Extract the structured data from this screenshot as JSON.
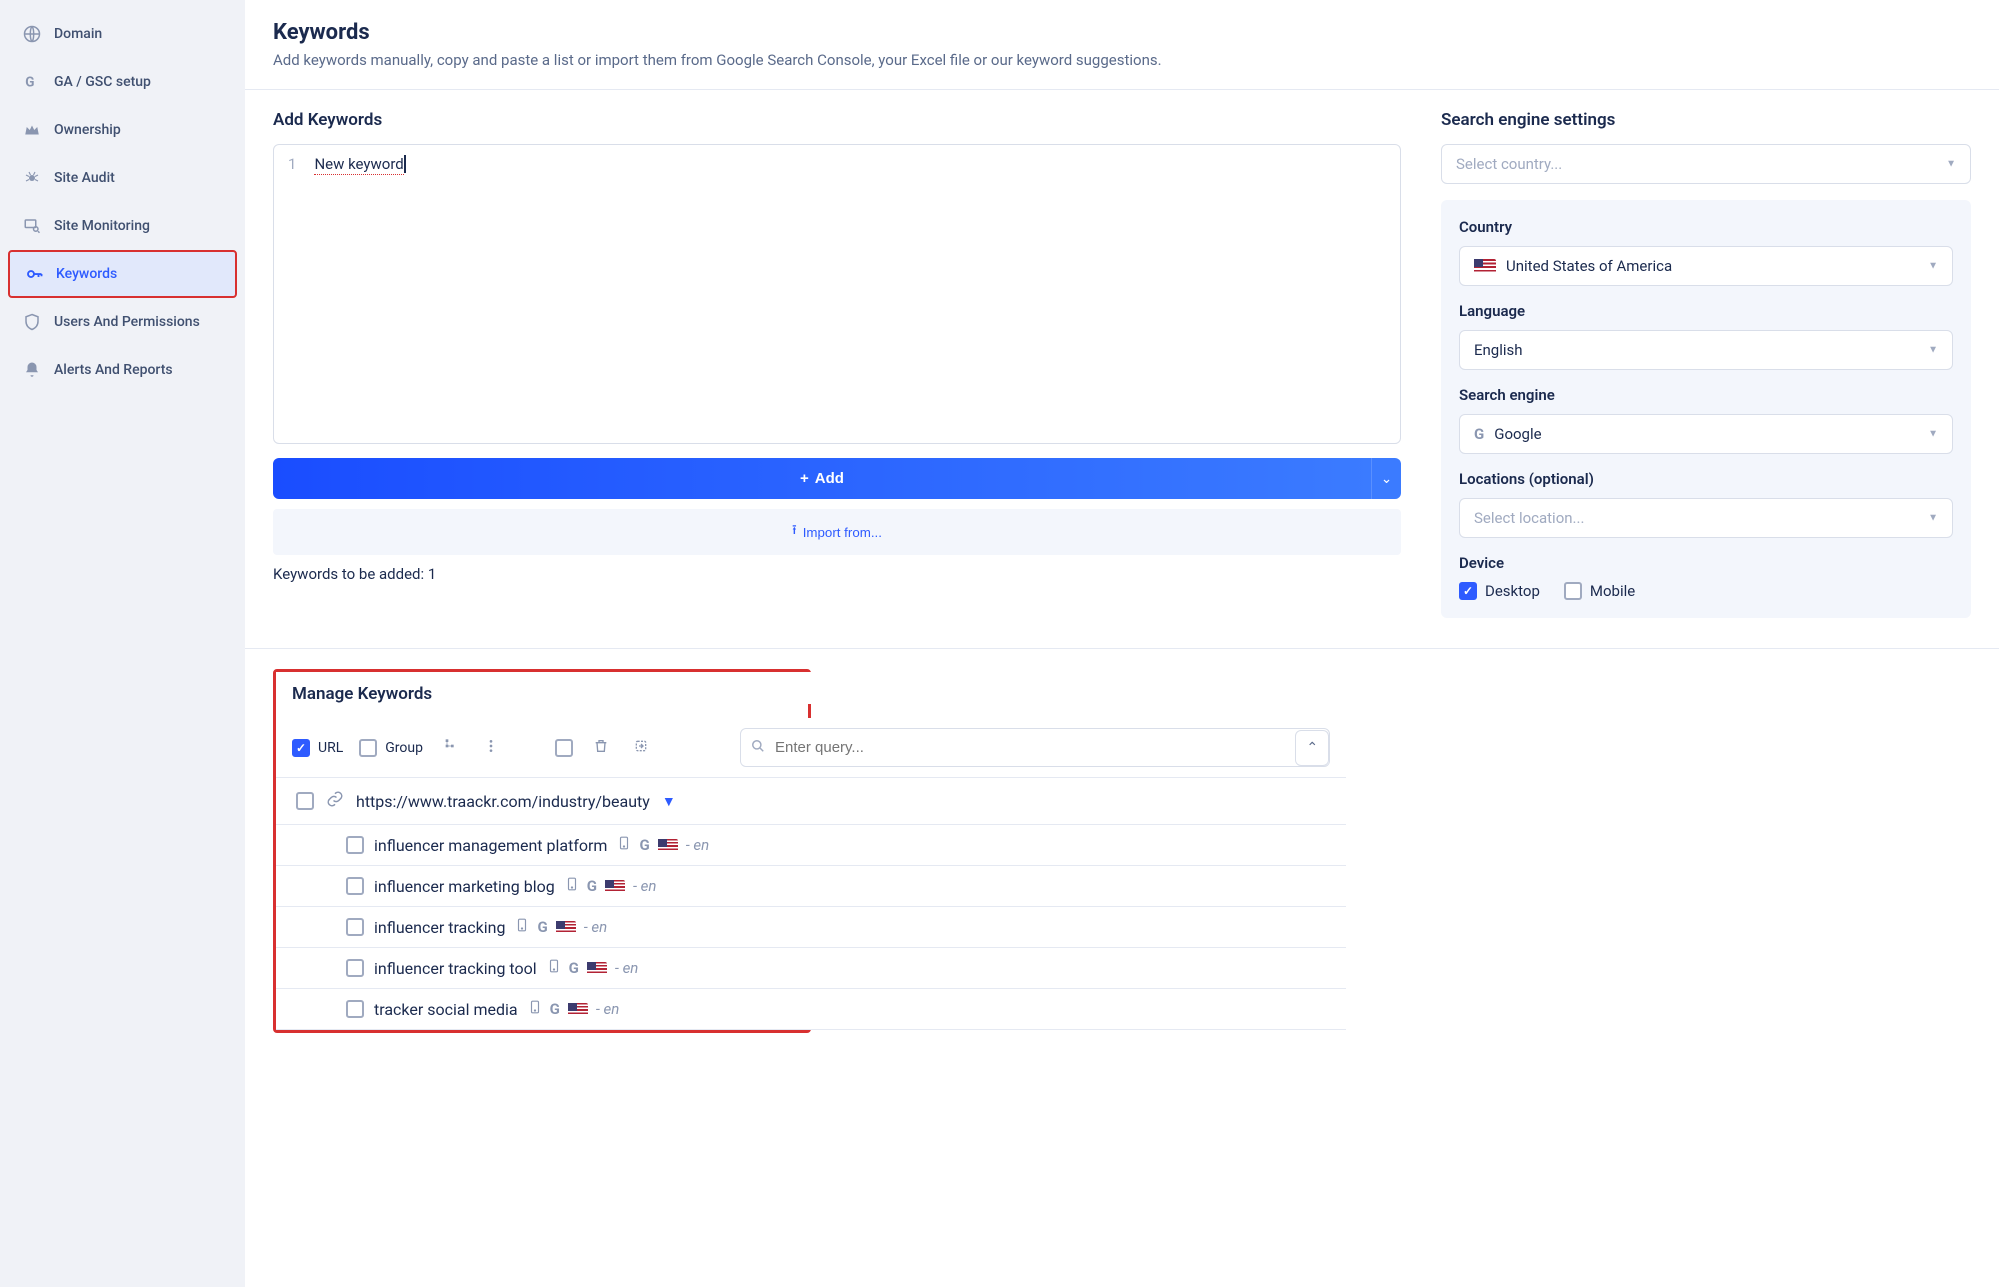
{
  "sidebar": {
    "items": [
      {
        "label": "Domain",
        "icon": "globe"
      },
      {
        "label": "GA / GSC setup",
        "icon": "g-logo"
      },
      {
        "label": "Ownership",
        "icon": "crown"
      },
      {
        "label": "Site Audit",
        "icon": "spider"
      },
      {
        "label": "Site Monitoring",
        "icon": "monitor-search"
      },
      {
        "label": "Keywords",
        "icon": "key",
        "active": true
      },
      {
        "label": "Users And Permissions",
        "icon": "shield"
      },
      {
        "label": "Alerts And Reports",
        "icon": "bell"
      }
    ]
  },
  "header": {
    "title": "Keywords",
    "subtitle": "Add keywords manually, copy and paste a list or import them from Google Search Console, your Excel file or our keyword suggestions."
  },
  "add_panel": {
    "title": "Add Keywords",
    "line_number": "1",
    "line_text": "New keyword",
    "add_button": "Add",
    "import_button": "Import from...",
    "count_text": "Keywords to be added: 1"
  },
  "settings_panel": {
    "title": "Search engine settings",
    "country_placeholder": "Select country...",
    "country_label": "Country",
    "country_value": "United States of America",
    "language_label": "Language",
    "language_value": "English",
    "engine_label": "Search engine",
    "engine_value": "Google",
    "locations_label": "Locations (optional)",
    "locations_placeholder": "Select location...",
    "device_label": "Device",
    "device_desktop": "Desktop",
    "device_mobile": "Mobile"
  },
  "manage": {
    "title": "Manage Keywords",
    "url_label": "URL",
    "group_label": "Group",
    "search_placeholder": "Enter query...",
    "group_url": "https://www.traackr.com/industry/beauty",
    "keywords": [
      {
        "name": "influencer management platform",
        "lang": "- en"
      },
      {
        "name": "influencer marketing blog",
        "lang": "- en"
      },
      {
        "name": "influencer tracking",
        "lang": "- en"
      },
      {
        "name": "influencer tracking tool",
        "lang": "- en"
      },
      {
        "name": "tracker social media",
        "lang": "- en"
      }
    ]
  }
}
